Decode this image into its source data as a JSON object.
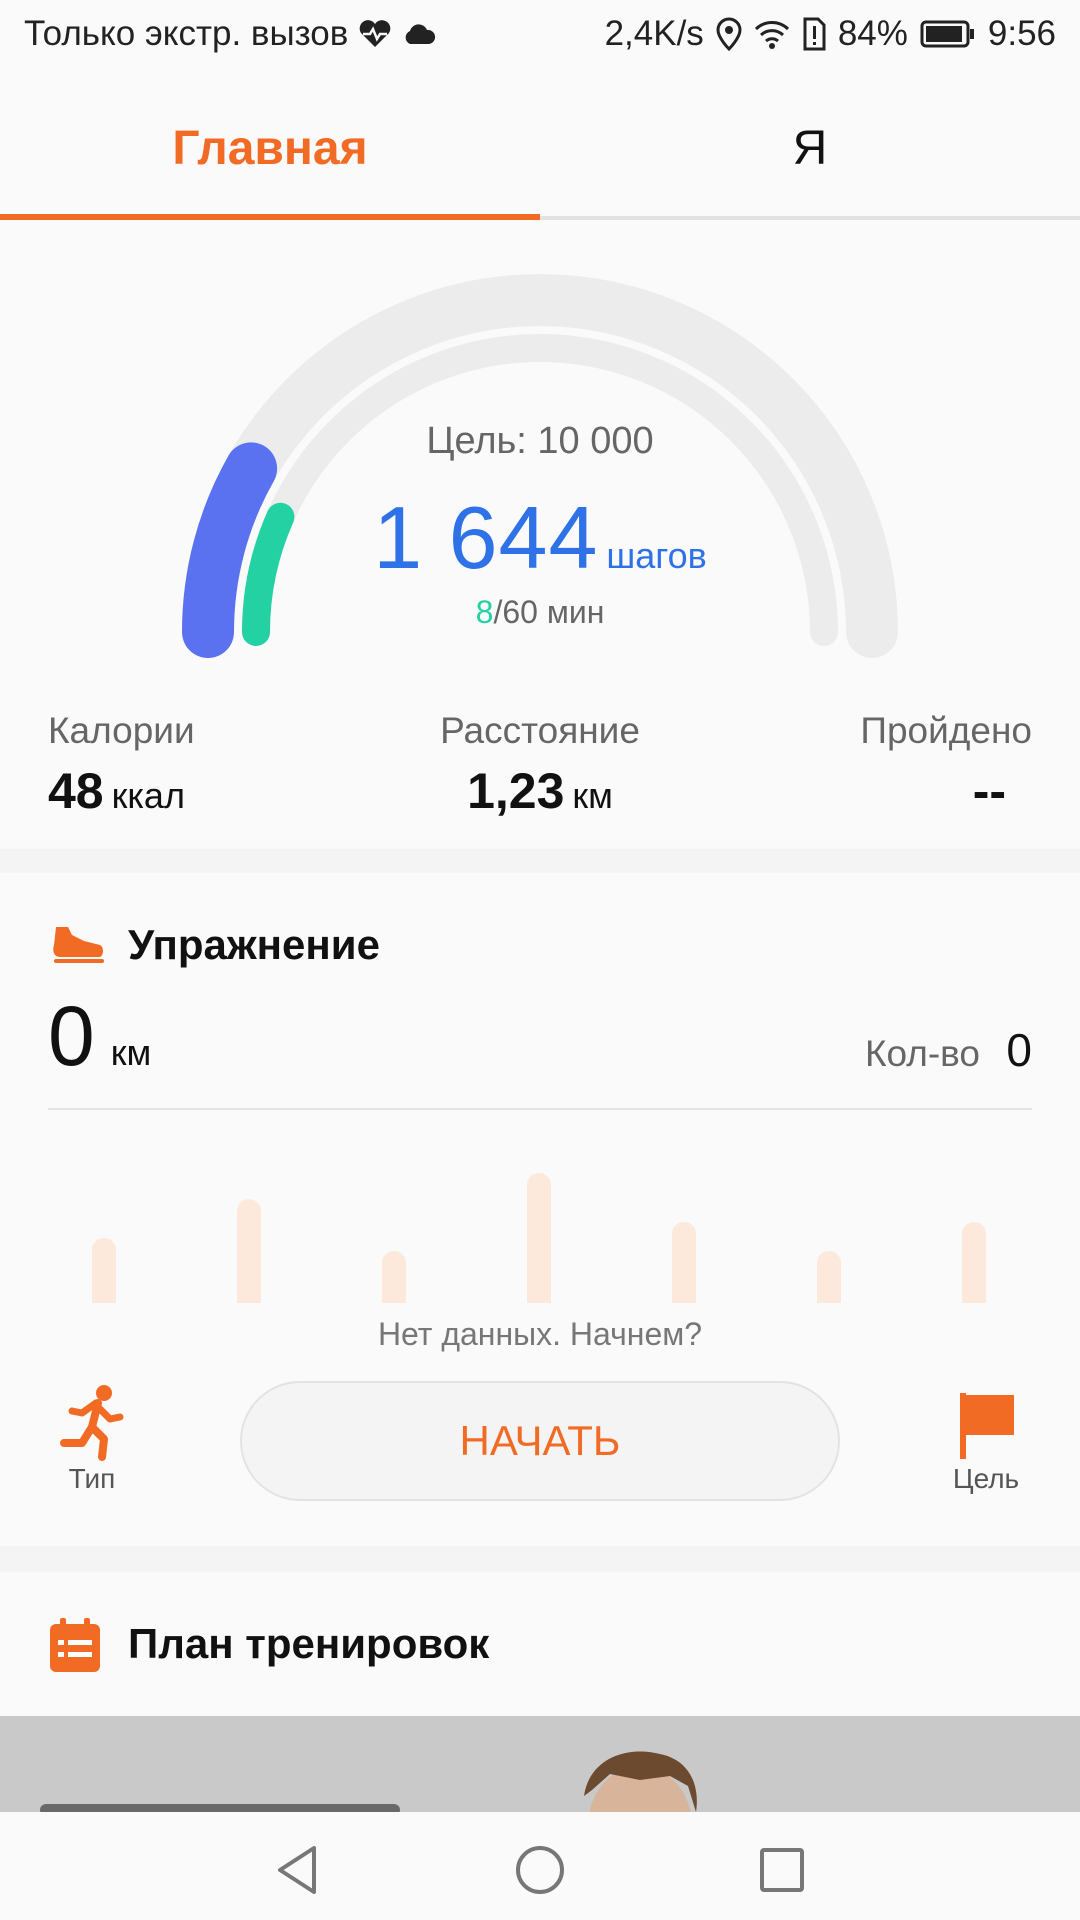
{
  "status_bar": {
    "carrier_text": "Только экстр. вызов",
    "speed": "2,4K/s",
    "battery": "84%",
    "time": "9:56"
  },
  "tabs": [
    {
      "label": "Главная",
      "active": true
    },
    {
      "label": "Я",
      "active": false
    }
  ],
  "summary": {
    "goal_label": "Цель: 10 000",
    "steps": "1 644",
    "steps_unit": "шагов",
    "active_minutes": "8",
    "minutes_goal": "/60 мин",
    "progress": {
      "steps_fraction": 0.164,
      "minutes_fraction": 0.133
    },
    "stats": [
      {
        "label": "Калории",
        "value": "48",
        "unit": "ккал"
      },
      {
        "label": "Расстояние",
        "value": "1,23",
        "unit": "км"
      },
      {
        "label": "Пройдено",
        "value": "--",
        "unit": ""
      }
    ]
  },
  "exercise": {
    "title": "Упражнение",
    "distance_value": "0",
    "distance_unit": "км",
    "count_label": "Кол-во",
    "count_value": "0",
    "no_data_text": "Нет данных. Начнем?",
    "start_label": "НАЧАТЬ",
    "type_label": "Тип",
    "goal_label": "Цель",
    "placeholder_bars": [
      0.5,
      0.8,
      0.4,
      1.0,
      0.62,
      0.4,
      0.62
    ]
  },
  "plan": {
    "title": "План тренировок"
  },
  "colors": {
    "accent": "#f26b25",
    "steps_blue": "#2f72e8",
    "minutes_green": "#23d1a3",
    "arc_blue": "#5a72f0",
    "arc_track": "#ececec"
  }
}
